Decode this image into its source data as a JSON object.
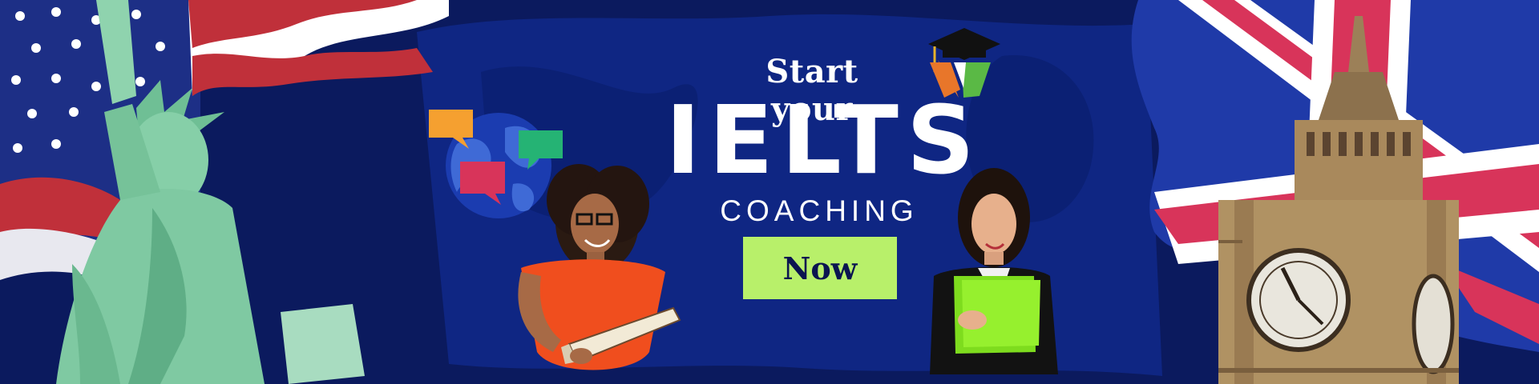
{
  "banner": {
    "line1": "Start your",
    "line2": "IELTS",
    "line3": "COACHING",
    "cta_label": "Now"
  },
  "colors": {
    "background": "#0b1a5e",
    "brush": "#0f2a86",
    "cta": "#b8f06a",
    "us_red": "#c0303a",
    "uk_red": "#d8345a",
    "statue": "#7fc9a2",
    "tower": "#a9895c"
  },
  "icons": [
    "graduation-cap-icon",
    "globe-chat-icon",
    "us-flag",
    "uk-flag",
    "statue-of-liberty",
    "big-ben"
  ]
}
